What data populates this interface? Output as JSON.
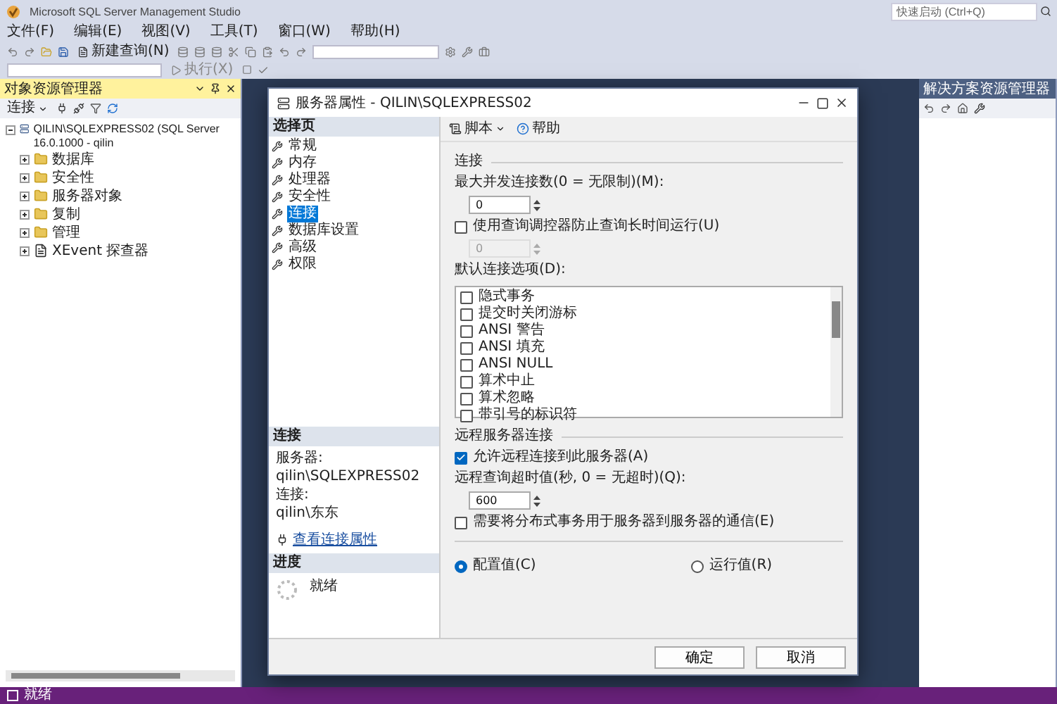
{
  "window": {
    "title": "Microsoft SQL Server Management Studio"
  },
  "quick_launch": {
    "placeholder": "快速启动 (Ctrl+Q)"
  },
  "menu": [
    "文件(F)",
    "编辑(E)",
    "视图(V)",
    "工具(T)",
    "窗口(W)",
    "帮助(H)"
  ],
  "toolbar": {
    "new_query": "新建查询(N)",
    "execute": "执行(X)"
  },
  "object_explorer": {
    "title": "对象资源管理器",
    "connect": "连接",
    "root": {
      "label": "QILIN\\SQLEXPRESS02 (SQL Server 16.0.1000 - qilin",
      "expanded": true,
      "children": [
        {
          "label": "数据库",
          "kind": "folder",
          "expanded": false
        },
        {
          "label": "安全性",
          "kind": "folder",
          "expanded": false
        },
        {
          "label": "服务器对象",
          "kind": "folder",
          "expanded": false
        },
        {
          "label": "复制",
          "kind": "folder",
          "expanded": false
        },
        {
          "label": "管理",
          "kind": "folder",
          "expanded": false
        },
        {
          "label": "XEvent 探查器",
          "kind": "profiler",
          "expanded": false
        }
      ]
    }
  },
  "solution_explorer": {
    "title": "解决方案资源管理器"
  },
  "dialog": {
    "title": "服务器属性 - QILIN\\SQLEXPRESS02",
    "pages_header": "选择页",
    "pages": [
      {
        "label": "常规",
        "selected": false
      },
      {
        "label": "内存",
        "selected": false
      },
      {
        "label": "处理器",
        "selected": false
      },
      {
        "label": "安全性",
        "selected": false
      },
      {
        "label": "连接",
        "selected": true
      },
      {
        "label": "数据库设置",
        "selected": false
      },
      {
        "label": "高级",
        "selected": false
      },
      {
        "label": "权限",
        "selected": false
      }
    ],
    "connection_header": "连接",
    "server_label": "服务器:",
    "server": "qilin\\SQLEXPRESS02",
    "login_label": "连接:",
    "login": "qilin\\东东",
    "view_properties": "查看连接属性",
    "progress_header": "进度",
    "progress_status": "就绪",
    "script": "脚本",
    "help": "帮助",
    "section_connections": "连接",
    "max_connections_label": "最大并发连接数(0 = 无限制)(M):",
    "max_connections": {
      "value": "0",
      "disabled": false
    },
    "governor": {
      "label": "使用查询调控器防止查询长时间运行(U)",
      "checked": false
    },
    "governor_value": {
      "value": "0",
      "disabled": true
    },
    "default_options_label": "默认连接选项(D):",
    "options": [
      {
        "label": "隐式事务",
        "checked": false
      },
      {
        "label": "提交时关闭游标",
        "checked": false
      },
      {
        "label": "ANSI 警告",
        "checked": false
      },
      {
        "label": "ANSI 填充",
        "checked": false
      },
      {
        "label": "ANSI NULL",
        "checked": false
      },
      {
        "label": "算术中止",
        "checked": false
      },
      {
        "label": "算术忽略",
        "checked": false
      },
      {
        "label": "带引号的标识符",
        "checked": false
      }
    ],
    "section_remote": "远程服务器连接",
    "allow_remote": {
      "label": "允许远程连接到此服务器(A)",
      "checked": true
    },
    "timeout_label": "远程查询超时值(秒, 0 = 无超时)(Q):",
    "timeout": {
      "value": "600",
      "disabled": false
    },
    "distributed": {
      "label": "需要将分布式事务用于服务器到服务器的通信(E)",
      "checked": false
    },
    "radios": [
      {
        "label": "配置值(C)",
        "selected": true
      },
      {
        "label": "运行值(R)",
        "selected": false
      }
    ],
    "buttons": [
      "确定",
      "取消"
    ]
  },
  "status_bar": {
    "text": "就绪"
  }
}
